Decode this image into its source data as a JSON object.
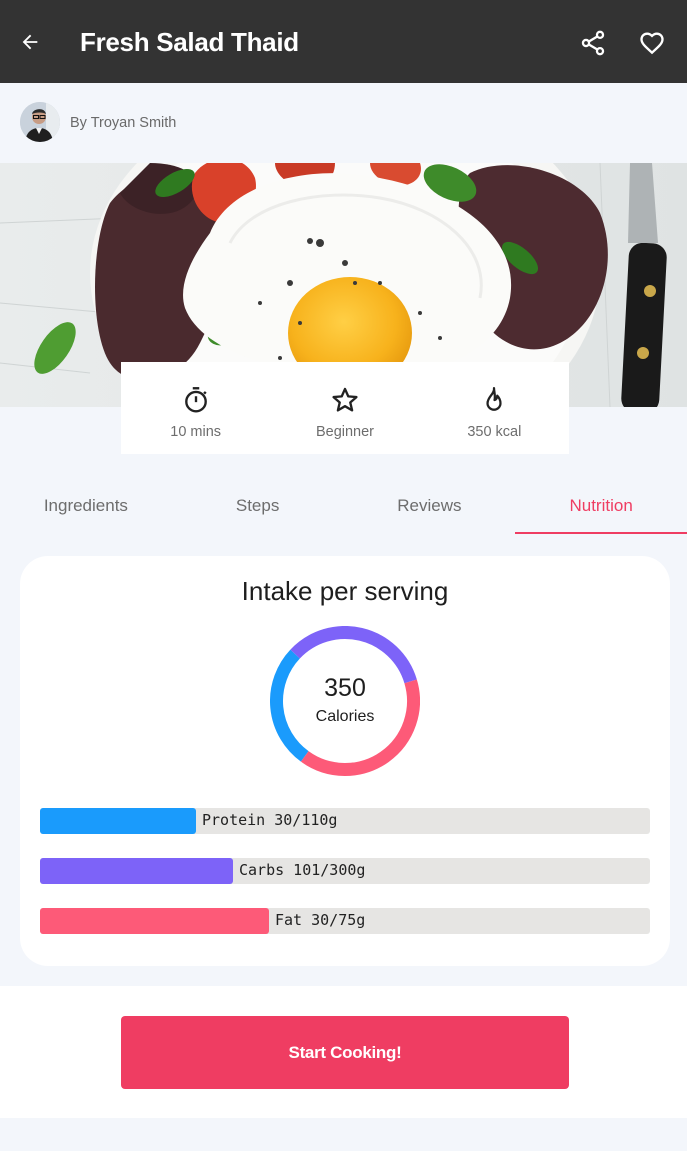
{
  "header": {
    "title": "Fresh Salad Thaid"
  },
  "author": {
    "name": "By Troyan Smith"
  },
  "stats": [
    {
      "icon": "timer-icon",
      "label": "10 mins"
    },
    {
      "icon": "star-icon",
      "label": "Beginner"
    },
    {
      "icon": "flame-icon",
      "label": "350 kcal"
    }
  ],
  "tabs": [
    {
      "label": "Ingredients"
    },
    {
      "label": "Steps"
    },
    {
      "label": "Reviews"
    },
    {
      "label": "Nutrition",
      "active": true
    }
  ],
  "nutrition": {
    "heading": "Intake per serving",
    "calories_value": "350",
    "calories_label": "Calories",
    "macros": [
      {
        "label": "Protein 30/110g",
        "amount": 30,
        "goal": 110,
        "color": "#1a9bfc"
      },
      {
        "label": "Carbs 101/300g",
        "amount": 101,
        "goal": 300,
        "color": "#7d63f8"
      },
      {
        "label": "Fat 30/75g",
        "amount": 30,
        "goal": 75,
        "color": "#fd5a78"
      }
    ]
  },
  "cta": {
    "label": "Start Cooking!"
  },
  "colors": {
    "accent": "#ef3d62",
    "appbar": "#333333"
  }
}
